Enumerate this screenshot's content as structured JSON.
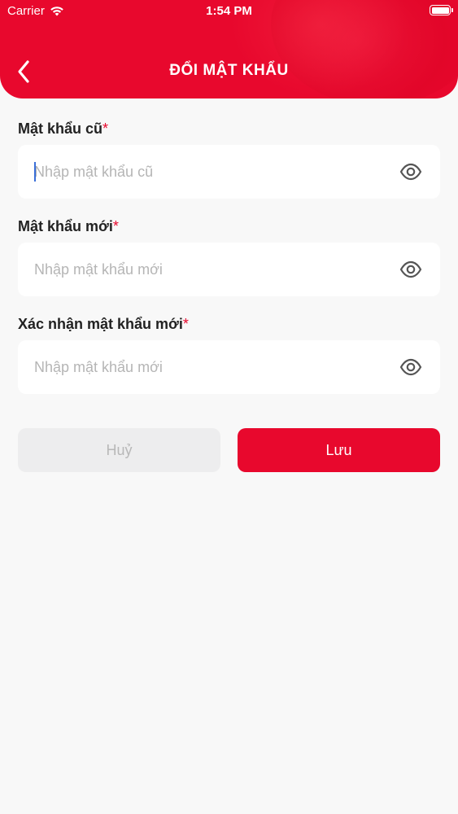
{
  "status_bar": {
    "carrier": "Carrier",
    "time": "1:54 PM"
  },
  "header": {
    "title": "ĐỔI MẬT KHẨU"
  },
  "fields": [
    {
      "label": "Mật khẩu cũ",
      "required_mark": "*",
      "placeholder": "Nhập mật khẩu cũ",
      "value": ""
    },
    {
      "label": "Mật khẩu mới",
      "required_mark": "*",
      "placeholder": "Nhập mật khẩu mới",
      "value": ""
    },
    {
      "label": "Xác nhận mật khẩu mới",
      "required_mark": "*",
      "placeholder": "Nhập mật khẩu mới",
      "value": ""
    }
  ],
  "buttons": {
    "cancel_label": "Huỷ",
    "save_label": "Lưu"
  },
  "colors": {
    "accent": "#e8082d",
    "background": "#f8f8f8",
    "required": "#e8082d"
  },
  "icons": {
    "back": "chevron-left-icon",
    "password_toggle": "eye-icon",
    "wifi": "wifi-icon",
    "battery": "battery-icon"
  }
}
